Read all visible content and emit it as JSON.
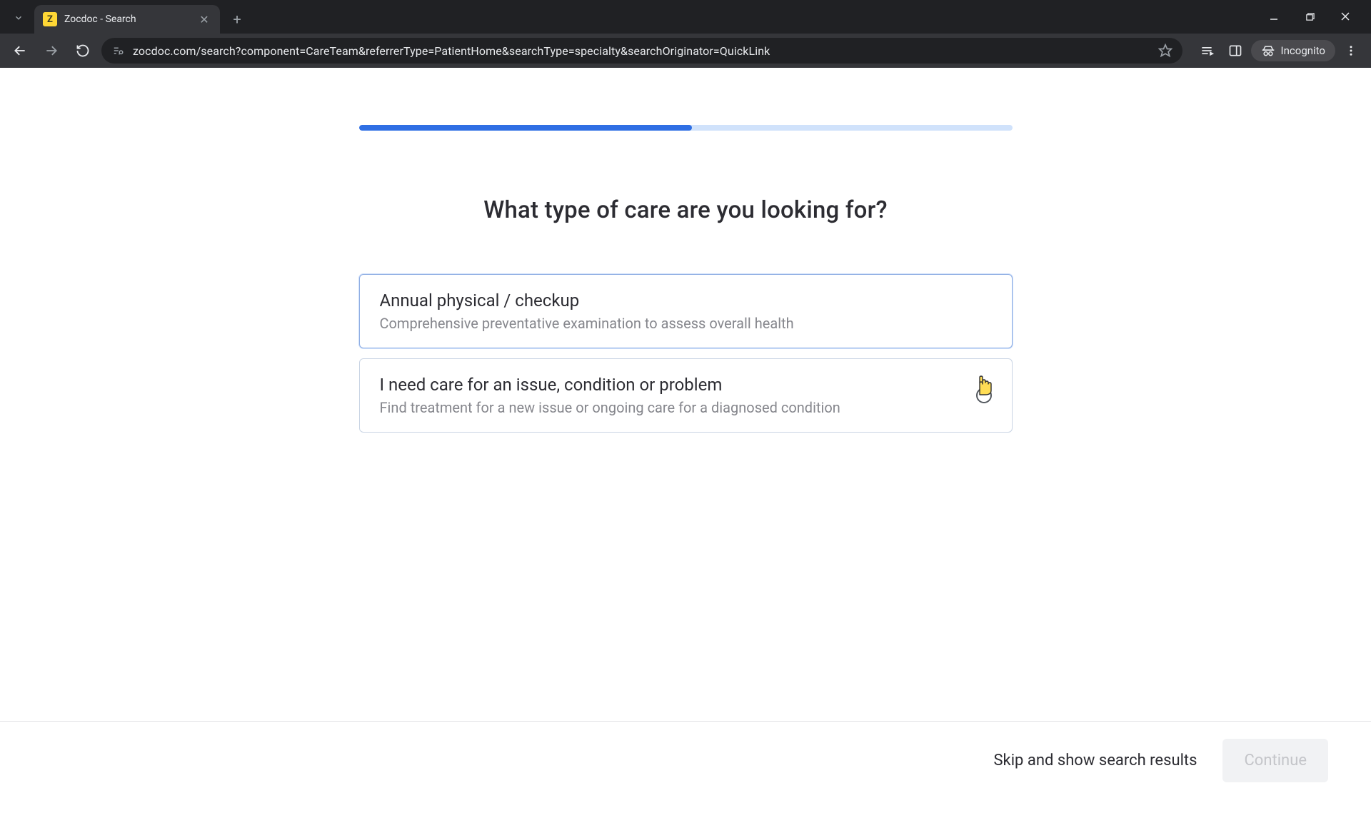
{
  "browser": {
    "tab_title": "Zocdoc - Search",
    "favicon_letter": "Z",
    "url": "zocdoc.com/search?component=CareTeam&referrerType=PatientHome&searchType=specialty&searchOriginator=QuickLink",
    "incognito_label": "Incognito"
  },
  "page": {
    "progress_percent": 51,
    "heading": "What type of care are you looking for?",
    "options": [
      {
        "title": "Annual physical / checkup",
        "desc": "Comprehensive preventative examination to assess overall health",
        "hovered": true
      },
      {
        "title": "I need care for an issue, condition or problem",
        "desc": "Find treatment for a new issue or ongoing care for a diagnosed condition",
        "hovered": false
      }
    ],
    "skip_label": "Skip and show search results",
    "continue_label": "Continue"
  }
}
